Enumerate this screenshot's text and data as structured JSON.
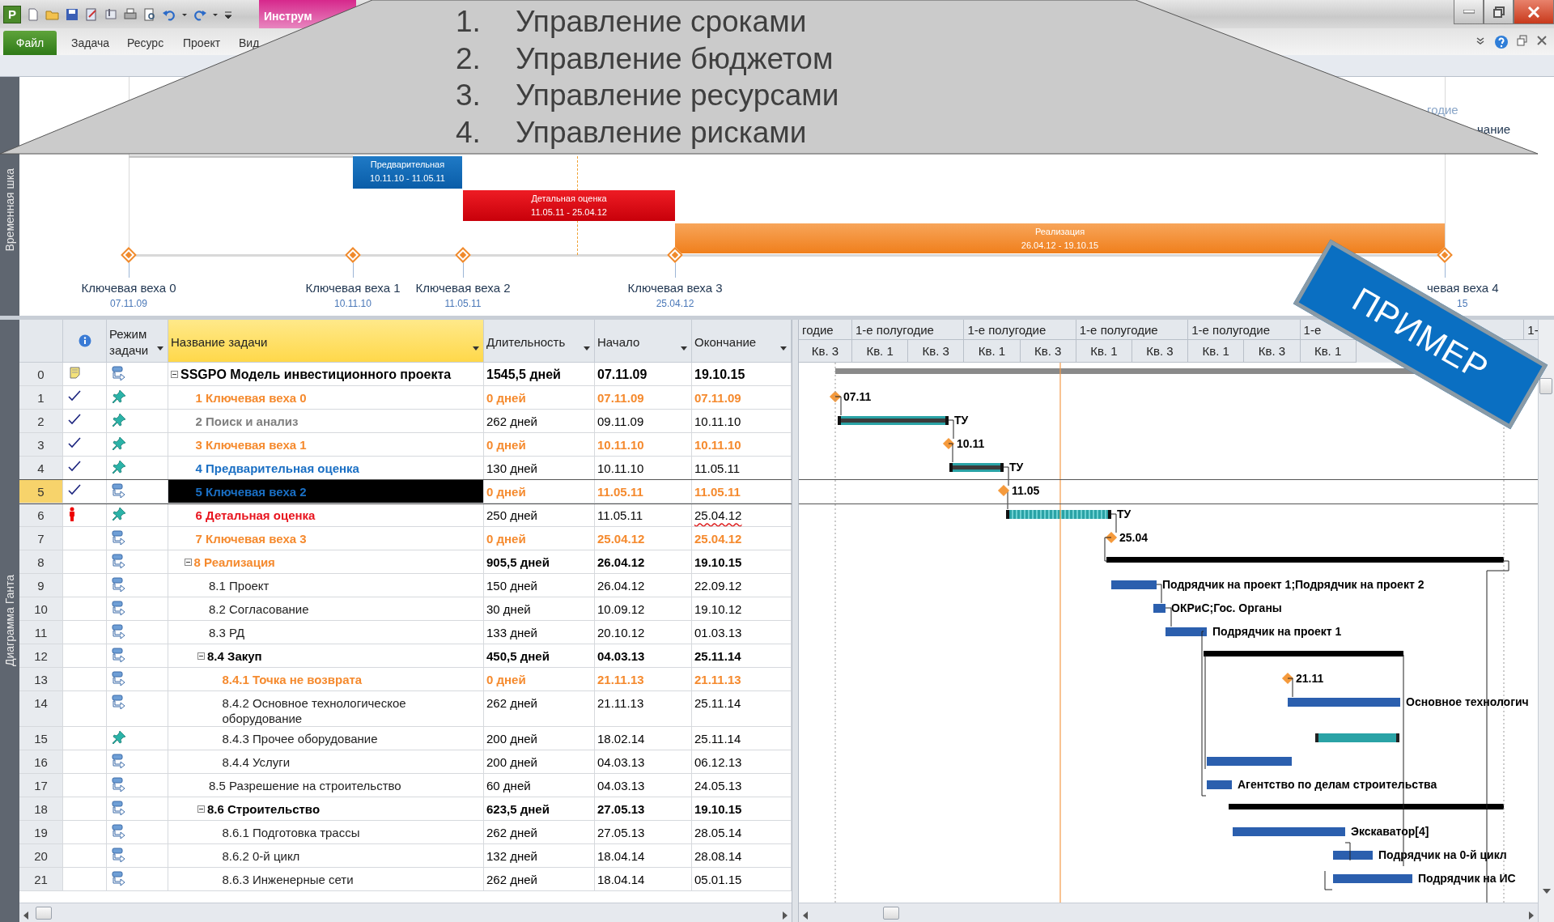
{
  "app_logo": "P",
  "context_tab": "Инструм",
  "ribbon_tabs": [
    {
      "label": "Файл",
      "selected": true
    },
    {
      "label": "Задача",
      "selected": false
    },
    {
      "label": "Ресурс",
      "selected": false
    },
    {
      "label": "Проект",
      "selected": false
    },
    {
      "label": "Вид",
      "selected": false
    }
  ],
  "overlay_list": [
    {
      "number": "1.",
      "text": "Управление сроками"
    },
    {
      "number": "2.",
      "text": "Управление бюджетом"
    },
    {
      "number": "3.",
      "text": "Управление ресурсами"
    },
    {
      "number": "4.",
      "text": "Управление рисками"
    }
  ],
  "timeline": {
    "side_label": "Временная шка",
    "edge_labels": [
      "годие",
      "чание"
    ],
    "bars": [
      {
        "kind": "blue",
        "title": "Предварительная",
        "dates": "10.11.10 - 11.05.11"
      },
      {
        "kind": "red",
        "title": "Детальная оценка",
        "dates": "11.05.11 - 25.04.12"
      },
      {
        "kind": "orange",
        "title": "Реализация",
        "dates": "26.04.12 - 19.10.15"
      }
    ],
    "milestones": [
      {
        "label": "Ключевая веха 0",
        "date": "07.11.09"
      },
      {
        "label": "Ключевая веха 1",
        "date": "10.11.10"
      },
      {
        "label": "Ключевая веха 2",
        "date": "11.05.11"
      },
      {
        "label": "Ключевая веха 3",
        "date": "25.04.12"
      },
      {
        "label": "чевая веха 4",
        "date": "15"
      }
    ]
  },
  "view_label": "Диаграмма Ганта",
  "columns": [
    {
      "label": "Режим задачи",
      "selected": false
    },
    {
      "label": "Название задачи",
      "selected": true
    },
    {
      "label": "Длительность",
      "selected": false
    },
    {
      "label": "Начало",
      "selected": false
    },
    {
      "label": "Окончание",
      "selected": false
    }
  ],
  "timescale": {
    "upper": [
      "годие",
      "1-е полугодие",
      "1-е полугодие",
      "1-е полугодие",
      "1-е полугодие",
      "1-е",
      "1-"
    ],
    "lower": [
      "Кв. 3",
      "Кв. 1",
      "Кв. 3",
      "Кв. 1",
      "Кв. 3",
      "Кв. 1",
      "Кв. 3",
      "Кв. 1",
      "Кв. 3",
      "Кв. 1"
    ]
  },
  "tasks": [
    {
      "id": "0",
      "name": "SSGPO Модель инвестиционного проекта",
      "duration": "1545,5 дней",
      "start": "07.11.09",
      "end": "19.10.15",
      "kind": "project",
      "color": "#000000",
      "manual": false,
      "done": false,
      "has_note": true,
      "overallocated": false,
      "selected": false,
      "end_flagged": false,
      "expanded": true,
      "bar": {
        "kind": "project"
      },
      "children": [
        {
          "id": "1",
          "name": "1 Ключевая веха 0",
          "duration": "0 дней",
          "start": "07.11.09",
          "end": "07.11.09",
          "kind": "milestone",
          "color": "#f58a2e",
          "manual": true,
          "done": true,
          "has_note": false,
          "overallocated": false,
          "selected": false,
          "end_flagged": false,
          "bar": {
            "kind": "milestone",
            "label": "07.11"
          }
        },
        {
          "id": "2",
          "name": "2 Поиск и анализ",
          "duration": "262 дней",
          "start": "09.11.09",
          "end": "10.11.10",
          "kind": "task",
          "color": "#7f7f7f",
          "manual": true,
          "done": true,
          "has_note": false,
          "overallocated": false,
          "selected": false,
          "end_flagged": false,
          "bar": {
            "kind": "manual_done",
            "label": "ТУ"
          }
        },
        {
          "id": "3",
          "name": "3 Ключевая веха 1",
          "duration": "0 дней",
          "start": "10.11.10",
          "end": "10.11.10",
          "kind": "milestone",
          "color": "#f58a2e",
          "manual": true,
          "done": true,
          "has_note": false,
          "overallocated": false,
          "selected": false,
          "end_flagged": false,
          "bar": {
            "kind": "milestone",
            "label": "10.11"
          }
        },
        {
          "id": "4",
          "name": "4 Предварительная оценка",
          "duration": "130 дней",
          "start": "10.11.10",
          "end": "11.05.11",
          "kind": "task",
          "color": "#1a6fc4",
          "manual": true,
          "done": true,
          "has_note": false,
          "overallocated": false,
          "selected": false,
          "end_flagged": false,
          "bar": {
            "kind": "manual_done",
            "label": "ТУ"
          }
        },
        {
          "id": "5",
          "name": "5 Ключевая веха 2",
          "duration": "0 дней",
          "start": "11.05.11",
          "end": "11.05.11",
          "kind": "milestone",
          "color": "#1a6fc4",
          "manual": false,
          "done": true,
          "has_note": false,
          "overallocated": false,
          "selected": true,
          "end_flagged": false,
          "bar": {
            "kind": "milestone",
            "label": "11.05"
          }
        },
        {
          "id": "6",
          "name": "6 Детальная оценка",
          "duration": "250 дней",
          "start": "11.05.11",
          "end": "25.04.12",
          "kind": "task",
          "color": "#e8141e",
          "manual": true,
          "done": false,
          "has_note": false,
          "overallocated": true,
          "selected": false,
          "end_flagged": true,
          "bar": {
            "kind": "manual_partial",
            "label": "ТУ"
          }
        },
        {
          "id": "7",
          "name": "7 Ключевая веха 3",
          "duration": "0 дней",
          "start": "25.04.12",
          "end": "25.04.12",
          "kind": "milestone",
          "color": "#f58a2e",
          "manual": false,
          "done": false,
          "has_note": false,
          "overallocated": false,
          "selected": false,
          "end_flagged": false,
          "bar": {
            "kind": "milestone",
            "label": "25.04"
          }
        },
        {
          "id": "8",
          "name": "8 Реализация",
          "duration": "905,5 дней",
          "start": "26.04.12",
          "end": "19.10.15",
          "kind": "summary",
          "color": "#f58a2e",
          "manual": false,
          "done": false,
          "has_note": false,
          "overallocated": false,
          "selected": false,
          "end_flagged": false,
          "expanded": true,
          "bar": {
            "kind": "summary"
          },
          "children": [
            {
              "id": "9",
              "name": "8.1 Проект",
              "duration": "150 дней",
              "start": "26.04.12",
              "end": "22.09.12",
              "kind": "task",
              "color": "#222222",
              "manual": false,
              "done": false,
              "has_note": false,
              "overallocated": false,
              "selected": false,
              "end_flagged": false,
              "bar": {
                "kind": "task",
                "label": "Подрядчик на проект 1;Подрядчик на проект 2"
              }
            },
            {
              "id": "10",
              "name": "8.2 Согласование",
              "duration": "30 дней",
              "start": "10.09.12",
              "end": "19.10.12",
              "kind": "task",
              "color": "#222222",
              "manual": false,
              "done": false,
              "has_note": false,
              "overallocated": false,
              "selected": false,
              "end_flagged": false,
              "bar": {
                "kind": "task",
                "label": "ОКРиС;Гос. Органы"
              }
            },
            {
              "id": "11",
              "name": "8.3 РД",
              "duration": "133 дней",
              "start": "20.10.12",
              "end": "01.03.13",
              "kind": "task",
              "color": "#222222",
              "manual": false,
              "done": false,
              "has_note": false,
              "overallocated": false,
              "selected": false,
              "end_flagged": false,
              "bar": {
                "kind": "task",
                "label": "Подрядчик на проект 1"
              }
            },
            {
              "id": "12",
              "name": "8.4 Закуп",
              "duration": "450,5 дней",
              "start": "04.03.13",
              "end": "25.11.14",
              "kind": "summary",
              "color": "#000000",
              "manual": false,
              "done": false,
              "has_note": false,
              "overallocated": false,
              "selected": false,
              "end_flagged": false,
              "expanded": true,
              "bar": {
                "kind": "summary"
              },
              "children": [
                {
                  "id": "13",
                  "name": "8.4.1 Точка не возврата",
                  "duration": "0 дней",
                  "start": "21.11.13",
                  "end": "21.11.13",
                  "kind": "milestone",
                  "color": "#f58a2e",
                  "manual": false,
                  "done": false,
                  "has_note": false,
                  "overallocated": false,
                  "selected": false,
                  "end_flagged": false,
                  "bar": {
                    "kind": "milestone",
                    "label": "21.11"
                  }
                },
                {
                  "id": "14",
                  "name": "8.4.2 Основное технологическое оборудование",
                  "duration": "262 дней",
                  "start": "21.11.13",
                  "end": "25.11.14",
                  "kind": "task",
                  "color": "#222222",
                  "manual": false,
                  "done": false,
                  "has_note": false,
                  "overallocated": false,
                  "selected": false,
                  "end_flagged": false,
                  "bar": {
                    "kind": "task",
                    "label": "Основное технологич"
                  }
                },
                {
                  "id": "15",
                  "name": "8.4.3 Прочее оборудование",
                  "duration": "200 дней",
                  "start": "18.02.14",
                  "end": "25.11.14",
                  "kind": "task",
                  "color": "#222222",
                  "manual": true,
                  "done": false,
                  "has_note": false,
                  "overallocated": false,
                  "selected": false,
                  "end_flagged": false,
                  "bar": {
                    "kind": "manual"
                  }
                },
                {
                  "id": "16",
                  "name": "8.4.4 Услуги",
                  "duration": "200 дней",
                  "start": "04.03.13",
                  "end": "06.12.13",
                  "kind": "task",
                  "color": "#222222",
                  "manual": false,
                  "done": false,
                  "has_note": false,
                  "overallocated": false,
                  "selected": false,
                  "end_flagged": false,
                  "bar": {
                    "kind": "task"
                  }
                }
              ]
            },
            {
              "id": "17",
              "name": "8.5 Разрешение на строительство",
              "duration": "60 дней",
              "start": "04.03.13",
              "end": "24.05.13",
              "kind": "task",
              "color": "#222222",
              "manual": false,
              "done": false,
              "has_note": false,
              "overallocated": false,
              "selected": false,
              "end_flagged": false,
              "bar": {
                "kind": "task",
                "label": "Агентство по делам строительства"
              }
            },
            {
              "id": "18",
              "name": "8.6 Строительство",
              "duration": "623,5 дней",
              "start": "27.05.13",
              "end": "19.10.15",
              "kind": "summary",
              "color": "#000000",
              "manual": false,
              "done": false,
              "has_note": false,
              "overallocated": false,
              "selected": false,
              "end_flagged": false,
              "expanded": true,
              "bar": {
                "kind": "summary"
              },
              "children": [
                {
                  "id": "19",
                  "name": "8.6.1 Подготовка трассы",
                  "duration": "262 дней",
                  "start": "27.05.13",
                  "end": "28.05.14",
                  "kind": "task",
                  "color": "#222222",
                  "manual": false,
                  "done": false,
                  "has_note": false,
                  "overallocated": false,
                  "selected": false,
                  "end_flagged": false,
                  "bar": {
                    "kind": "task",
                    "label": "Экскаватор[4]"
                  }
                },
                {
                  "id": "20",
                  "name": "8.6.2 0-й цикл",
                  "duration": "132 дней",
                  "start": "18.04.14",
                  "end": "28.08.14",
                  "kind": "task",
                  "color": "#222222",
                  "manual": false,
                  "done": false,
                  "has_note": false,
                  "overallocated": false,
                  "selected": false,
                  "end_flagged": false,
                  "bar": {
                    "kind": "task",
                    "label": "Подрядчик на 0-й цикл"
                  }
                },
                {
                  "id": "21",
                  "name": "8.6.3 Инженерные сети",
                  "duration": "262 дней",
                  "start": "18.04.14",
                  "end": "05.01.15",
                  "kind": "task",
                  "color": "#222222",
                  "manual": false,
                  "done": false,
                  "has_note": false,
                  "overallocated": false,
                  "selected": false,
                  "end_flagged": false,
                  "bar": {
                    "kind": "task",
                    "label": "Подрядчик на ИС"
                  }
                }
              ]
            }
          ]
        }
      ]
    }
  ],
  "stamp": "ПРИМЕР"
}
